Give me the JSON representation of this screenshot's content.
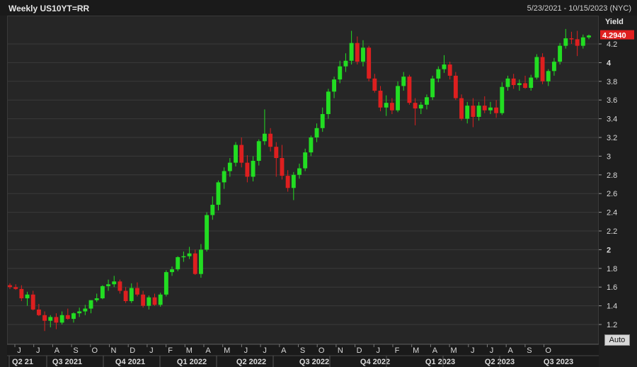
{
  "header": {
    "title": "Weekly US10YT=RR",
    "date_range": "5/23/2021 - 10/15/2023 (NYC)"
  },
  "auto_label": "Auto",
  "colors": {
    "up": "#22dd22",
    "down": "#dd1f1f",
    "last_price_bg": "#e01f1f",
    "grid": "#3a3a3a",
    "text": "#d9d9d9"
  },
  "chart_data": {
    "type": "candlestick",
    "title": "Weekly US10YT=RR",
    "ylabel": "Yield",
    "ylim": [
      1.1,
      4.4
    ],
    "yticks": [
      1.2,
      1.4,
      1.6,
      1.8,
      2,
      2.2,
      2.4,
      2.6,
      2.8,
      3,
      3.2,
      3.4,
      3.6,
      3.8,
      4,
      4.2
    ],
    "ytick_labels": [
      "1.2",
      "1.4",
      "1.6",
      "1.8",
      "2",
      "2.2",
      "2.4",
      "2.6",
      "2.8",
      "3",
      "3.2",
      "3.4",
      "3.6",
      "3.8",
      "4",
      "4.2"
    ],
    "last_price": 4.294,
    "last_price_label": "4.2940",
    "month_labels": [
      "J",
      "J",
      "A",
      "S",
      "O",
      "N",
      "D",
      "J",
      "F",
      "M",
      "A",
      "M",
      "J",
      "J",
      "A",
      "S",
      "O",
      "N",
      "D",
      "J",
      "F",
      "M",
      "A",
      "M",
      "J",
      "J",
      "A",
      "S",
      "O"
    ],
    "quarter_labels": [
      "Q2 21",
      "Q3 2021",
      "Q4 2021",
      "Q1 2022",
      "Q2 2022",
      "Q3 2022",
      "Q4 2022",
      "Q1 2023",
      "Q2 2023",
      "Q3 2023"
    ],
    "candles": [
      [
        1.62,
        1.64,
        1.58,
        1.6
      ],
      [
        1.6,
        1.63,
        1.57,
        1.58
      ],
      [
        1.58,
        1.62,
        1.45,
        1.48
      ],
      [
        1.48,
        1.55,
        1.4,
        1.52
      ],
      [
        1.52,
        1.56,
        1.35,
        1.36
      ],
      [
        1.36,
        1.42,
        1.29,
        1.3
      ],
      [
        1.3,
        1.34,
        1.13,
        1.24
      ],
      [
        1.24,
        1.3,
        1.17,
        1.28
      ],
      [
        1.28,
        1.32,
        1.15,
        1.22
      ],
      [
        1.22,
        1.34,
        1.2,
        1.3
      ],
      [
        1.3,
        1.37,
        1.25,
        1.26
      ],
      [
        1.26,
        1.33,
        1.22,
        1.32
      ],
      [
        1.32,
        1.38,
        1.28,
        1.34
      ],
      [
        1.34,
        1.41,
        1.3,
        1.37
      ],
      [
        1.37,
        1.45,
        1.32,
        1.46
      ],
      [
        1.46,
        1.53,
        1.44,
        1.48
      ],
      [
        1.48,
        1.62,
        1.47,
        1.61
      ],
      [
        1.61,
        1.68,
        1.56,
        1.63
      ],
      [
        1.63,
        1.72,
        1.6,
        1.66
      ],
      [
        1.66,
        1.68,
        1.53,
        1.56
      ],
      [
        1.56,
        1.6,
        1.43,
        1.45
      ],
      [
        1.45,
        1.64,
        1.43,
        1.59
      ],
      [
        1.59,
        1.65,
        1.5,
        1.52
      ],
      [
        1.52,
        1.56,
        1.38,
        1.4
      ],
      [
        1.4,
        1.51,
        1.36,
        1.49
      ],
      [
        1.49,
        1.53,
        1.4,
        1.41
      ],
      [
        1.41,
        1.54,
        1.39,
        1.52
      ],
      [
        1.52,
        1.78,
        1.5,
        1.76
      ],
      [
        1.76,
        1.82,
        1.72,
        1.79
      ],
      [
        1.79,
        1.93,
        1.77,
        1.92
      ],
      [
        1.92,
        1.98,
        1.87,
        1.93
      ],
      [
        1.93,
        2.03,
        1.9,
        1.96
      ],
      [
        1.96,
        2.0,
        1.73,
        1.74
      ],
      [
        1.74,
        2.06,
        1.7,
        2.0
      ],
      [
        2.0,
        2.4,
        1.98,
        2.37
      ],
      [
        2.37,
        2.57,
        2.32,
        2.48
      ],
      [
        2.48,
        2.74,
        2.42,
        2.72
      ],
      [
        2.72,
        2.88,
        2.65,
        2.84
      ],
      [
        2.84,
        2.98,
        2.78,
        2.93
      ],
      [
        2.93,
        3.15,
        2.89,
        3.12
      ],
      [
        3.12,
        3.2,
        2.88,
        2.93
      ],
      [
        2.93,
        3.01,
        2.72,
        2.78
      ],
      [
        2.78,
        3.0,
        2.73,
        2.95
      ],
      [
        2.95,
        3.18,
        2.9,
        3.16
      ],
      [
        3.16,
        3.5,
        3.12,
        3.24
      ],
      [
        3.24,
        3.3,
        3.05,
        3.1
      ],
      [
        3.1,
        3.15,
        2.78,
        2.98
      ],
      [
        2.98,
        3.12,
        2.75,
        2.79
      ],
      [
        2.79,
        2.85,
        2.62,
        2.66
      ],
      [
        2.66,
        2.83,
        2.53,
        2.8
      ],
      [
        2.8,
        2.92,
        2.76,
        2.87
      ],
      [
        2.87,
        3.08,
        2.84,
        3.04
      ],
      [
        3.04,
        3.22,
        3.0,
        3.2
      ],
      [
        3.2,
        3.35,
        3.15,
        3.3
      ],
      [
        3.3,
        3.52,
        3.26,
        3.45
      ],
      [
        3.45,
        3.72,
        3.4,
        3.69
      ],
      [
        3.69,
        3.85,
        3.62,
        3.82
      ],
      [
        3.82,
        4.02,
        3.78,
        3.96
      ],
      [
        3.96,
        4.1,
        3.9,
        4.02
      ],
      [
        4.02,
        4.34,
        3.98,
        4.21
      ],
      [
        4.21,
        4.28,
        3.98,
        4.01
      ],
      [
        4.01,
        4.24,
        3.96,
        4.16
      ],
      [
        4.16,
        4.18,
        3.8,
        3.83
      ],
      [
        3.83,
        3.88,
        3.68,
        3.7
      ],
      [
        3.7,
        3.75,
        3.48,
        3.52
      ],
      [
        3.52,
        3.65,
        3.43,
        3.57
      ],
      [
        3.57,
        3.62,
        3.45,
        3.49
      ],
      [
        3.49,
        3.8,
        3.47,
        3.75
      ],
      [
        3.75,
        3.9,
        3.7,
        3.85
      ],
      [
        3.85,
        3.87,
        3.55,
        3.57
      ],
      [
        3.57,
        3.62,
        3.33,
        3.51
      ],
      [
        3.51,
        3.58,
        3.45,
        3.55
      ],
      [
        3.55,
        3.66,
        3.5,
        3.63
      ],
      [
        3.63,
        3.86,
        3.6,
        3.83
      ],
      [
        3.83,
        3.96,
        3.79,
        3.93
      ],
      [
        3.93,
        4.08,
        3.89,
        3.98
      ],
      [
        3.98,
        4.01,
        3.82,
        3.86
      ],
      [
        3.86,
        3.9,
        3.6,
        3.62
      ],
      [
        3.62,
        3.66,
        3.38,
        3.4
      ],
      [
        3.4,
        3.58,
        3.35,
        3.54
      ],
      [
        3.54,
        3.62,
        3.31,
        3.42
      ],
      [
        3.42,
        3.58,
        3.38,
        3.54
      ],
      [
        3.54,
        3.64,
        3.46,
        3.49
      ],
      [
        3.49,
        3.58,
        3.45,
        3.52
      ],
      [
        3.52,
        3.6,
        3.41,
        3.46
      ],
      [
        3.46,
        3.79,
        3.44,
        3.74
      ],
      [
        3.74,
        3.86,
        3.7,
        3.83
      ],
      [
        3.83,
        3.88,
        3.72,
        3.76
      ],
      [
        3.76,
        3.82,
        3.7,
        3.78
      ],
      [
        3.78,
        3.86,
        3.72,
        3.73
      ],
      [
        3.73,
        3.87,
        3.7,
        3.84
      ],
      [
        3.84,
        4.09,
        3.82,
        4.06
      ],
      [
        4.06,
        4.1,
        3.77,
        3.8
      ],
      [
        3.8,
        3.93,
        3.75,
        3.91
      ],
      [
        3.91,
        4.05,
        3.86,
        4.01
      ],
      [
        4.01,
        4.21,
        3.98,
        4.18
      ],
      [
        4.18,
        4.36,
        4.15,
        4.26
      ],
      [
        4.26,
        4.33,
        4.2,
        4.25
      ],
      [
        4.25,
        4.34,
        4.07,
        4.18
      ],
      [
        4.18,
        4.3,
        4.15,
        4.27
      ],
      [
        4.27,
        4.3,
        4.25,
        4.29
      ]
    ]
  }
}
